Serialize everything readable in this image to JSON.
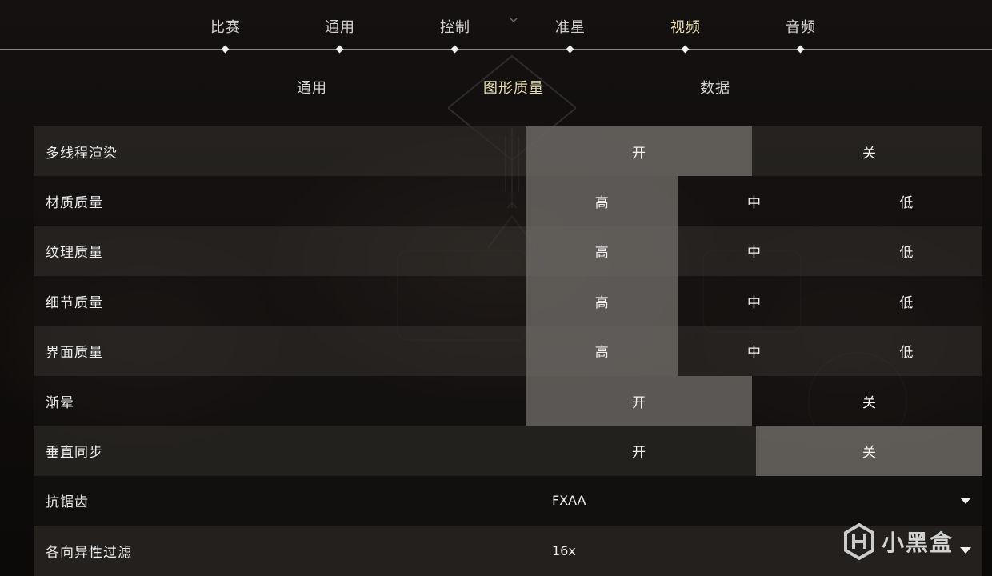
{
  "top_nav": {
    "tabs": [
      {
        "label": "比赛"
      },
      {
        "label": "通用"
      },
      {
        "label": "控制"
      },
      {
        "label": "准星"
      },
      {
        "label": "视频"
      },
      {
        "label": "音频"
      }
    ],
    "active_tab": "视频"
  },
  "sub_nav": {
    "tabs": [
      {
        "label": "通用"
      },
      {
        "label": "图形质量"
      },
      {
        "label": "数据"
      }
    ],
    "active_tab": "图形质量"
  },
  "settings": {
    "rows": [
      {
        "label": "多线程渲染",
        "options": [
          "开",
          "关"
        ],
        "selected": "开"
      },
      {
        "label": "材质质量",
        "options": [
          "高",
          "中",
          "低"
        ],
        "selected": "高"
      },
      {
        "label": "纹理质量",
        "options": [
          "高",
          "中",
          "低"
        ],
        "selected": "高"
      },
      {
        "label": "细节质量",
        "options": [
          "高",
          "中",
          "低"
        ],
        "selected": "高"
      },
      {
        "label": "界面质量",
        "options": [
          "高",
          "中",
          "低"
        ],
        "selected": "高"
      },
      {
        "label": "渐晕",
        "options": [
          "开",
          "关"
        ],
        "selected": "开"
      },
      {
        "label": "垂直同步",
        "options": [
          "开",
          "关"
        ],
        "selected": "关"
      },
      {
        "label": "抗锯齿",
        "value": "FXAA"
      },
      {
        "label": "各向异性过滤",
        "value": "16x"
      }
    ]
  },
  "watermark": {
    "text": "小黑盒"
  },
  "colors": {
    "active_tab": "#e8dfae",
    "selected_option": "#706c68"
  }
}
